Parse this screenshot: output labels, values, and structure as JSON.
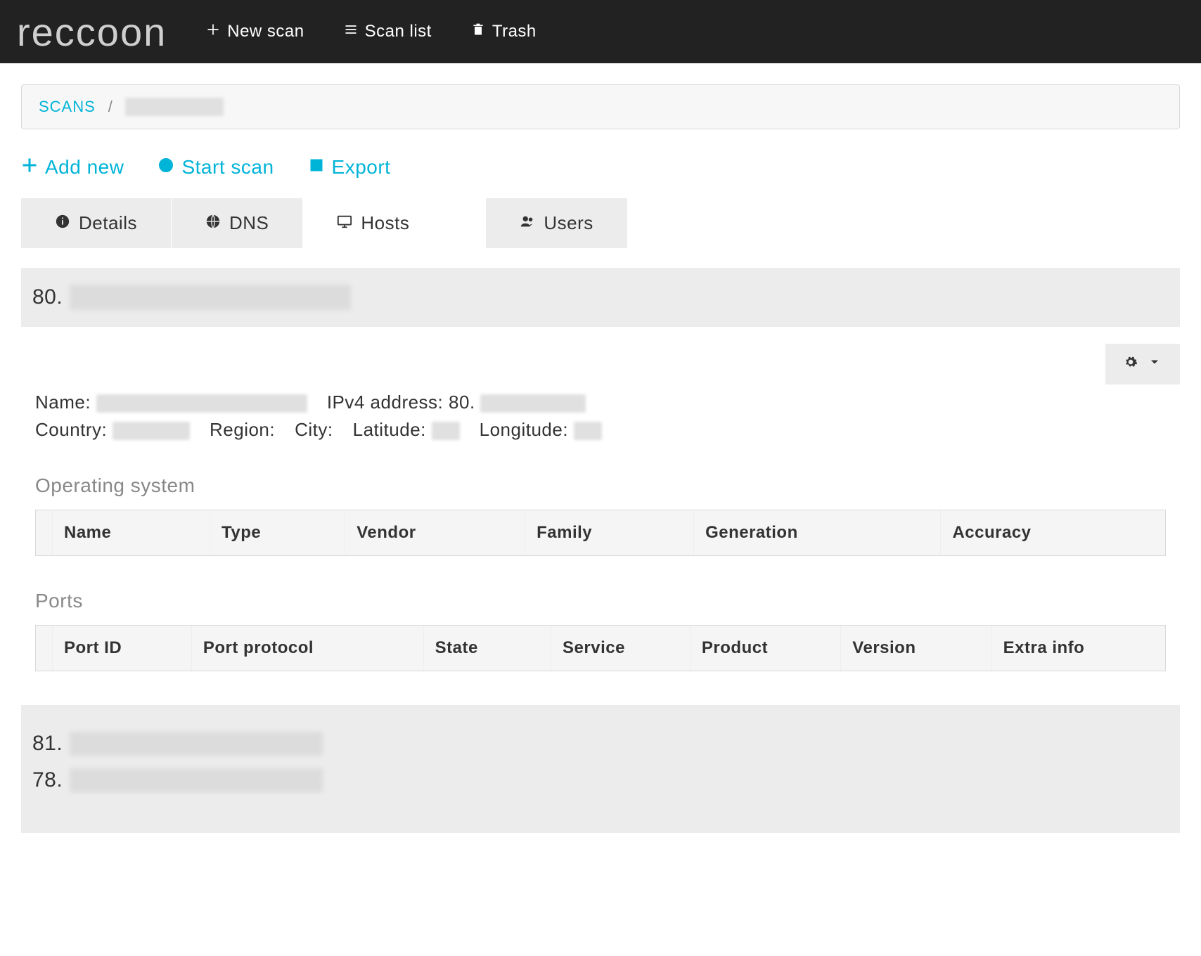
{
  "brand": "reccoon",
  "topnav": {
    "new_scan": "New scan",
    "scan_list": "Scan list",
    "trash": "Trash"
  },
  "breadcrumb": {
    "root": "SCANS"
  },
  "actions": {
    "add_new": "Add new",
    "start_scan": "Start scan",
    "export": "Export"
  },
  "tabs": {
    "details": "Details",
    "dns": "DNS",
    "hosts": "Hosts",
    "users": "Users",
    "active": "hosts"
  },
  "current_host": {
    "prefix": "80.",
    "fields": {
      "name_label": "Name:",
      "ipv4_label": "IPv4 address:",
      "ipv4_prefix": "80.",
      "country_label": "Country:",
      "region_label": "Region:",
      "city_label": "City:",
      "latitude_label": "Latitude:",
      "longitude_label": "Longitude:"
    }
  },
  "sections": {
    "os_title": "Operating system",
    "os_columns": [
      "Name",
      "Type",
      "Vendor",
      "Family",
      "Generation",
      "Accuracy"
    ],
    "ports_title": "Ports",
    "ports_columns": [
      "Port ID",
      "Port protocol",
      "State",
      "Service",
      "Product",
      "Version",
      "Extra info"
    ]
  },
  "other_hosts": [
    {
      "prefix": "81."
    },
    {
      "prefix": "78."
    }
  ]
}
